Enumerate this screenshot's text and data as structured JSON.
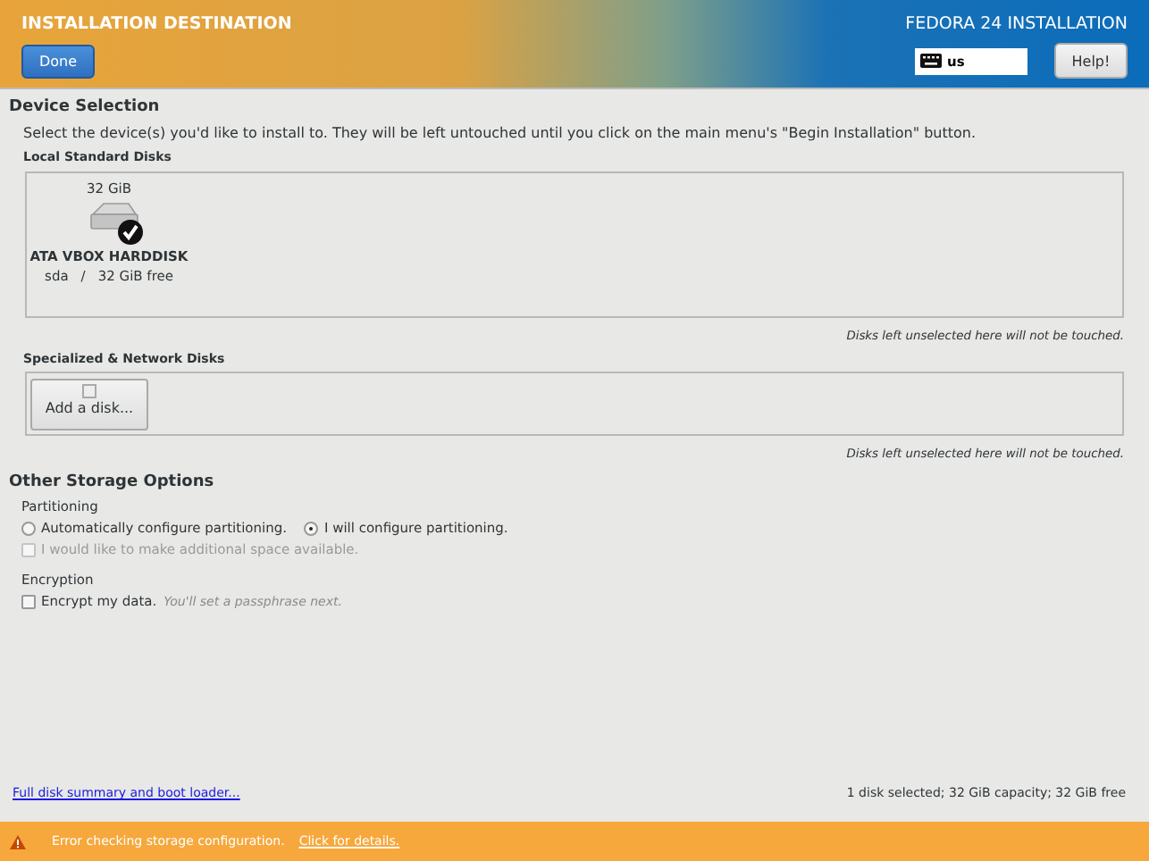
{
  "header": {
    "title": "INSTALLATION DESTINATION",
    "product": "FEDORA 24 INSTALLATION",
    "keyboard_layout": "us",
    "done_button": "Done",
    "help_button": "Help!"
  },
  "device_selection": {
    "heading": "Device Selection",
    "instructions": "Select the device(s) you'd like to install to.  They will be left untouched until you click on the main menu's \"Begin Installation\" button.",
    "local_disks": {
      "heading": "Local Standard Disks",
      "disks": [
        {
          "size": "32 GiB",
          "name": "ATA VBOX HARDDISK",
          "device": "sda",
          "separator": "/",
          "free": "32 GiB free",
          "selected": true
        }
      ],
      "note": "Disks left unselected here will not be touched."
    },
    "specialized_disks": {
      "heading": "Specialized & Network Disks",
      "add_button": "Add a disk...",
      "note": "Disks left unselected here will not be touched."
    }
  },
  "other_options": {
    "heading": "Other Storage Options",
    "partitioning": {
      "heading": "Partitioning",
      "options": [
        {
          "label": "Automatically configure partitioning.",
          "selected": false
        },
        {
          "label": "I will configure partitioning.",
          "selected": true
        }
      ],
      "reclaim": {
        "label": "I would like to make additional space available.",
        "checked": false,
        "disabled": true
      }
    },
    "encryption": {
      "heading": "Encryption",
      "encrypt": {
        "label": "Encrypt my data.",
        "hint": "You'll set a passphrase next.",
        "checked": false,
        "disabled": false
      }
    }
  },
  "footer": {
    "link": "Full disk summary and boot loader...",
    "summary": "1 disk selected; 32 GiB capacity; 32 GiB free"
  },
  "error_bar": {
    "message": "Error checking storage configuration.",
    "link": "Click for details."
  }
}
